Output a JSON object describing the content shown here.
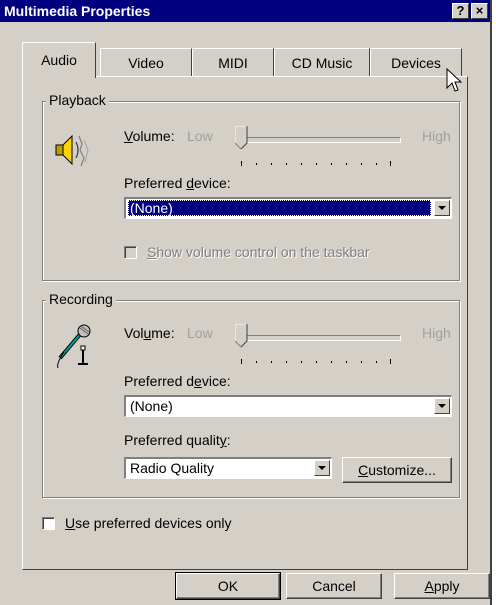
{
  "window": {
    "title": "Multimedia Properties",
    "help_glyph": "?",
    "close_glyph": "×"
  },
  "tabs": [
    {
      "label": "Audio",
      "active": true
    },
    {
      "label": "Video",
      "active": false
    },
    {
      "label": "MIDI",
      "active": false
    },
    {
      "label": "CD Music",
      "active": false
    },
    {
      "label": "Devices",
      "active": false
    }
  ],
  "playback": {
    "group_label": "Playback",
    "icon": "speaker-icon",
    "volume_label_pre": "",
    "volume_label_u": "V",
    "volume_label_post": "olume:",
    "low_label": "Low",
    "high_label": "High",
    "volume_level": 0,
    "preferred_device_label_pre": "Preferred ",
    "preferred_device_label_u": "d",
    "preferred_device_label_post": "evice:",
    "preferred_device_value": "(None)",
    "show_volume_u": "S",
    "show_volume_rest": "how volume control on the taskbar"
  },
  "recording": {
    "group_label": "Recording",
    "icon": "microphone-icon",
    "volume_label_pre": "Vol",
    "volume_label_u": "u",
    "volume_label_post": "me:",
    "low_label": "Low",
    "high_label": "High",
    "volume_level": 0,
    "preferred_device_label_pre": "Preferred d",
    "preferred_device_label_u": "e",
    "preferred_device_label_post": "vice:",
    "preferred_device_value": "(None)",
    "preferred_quality_label_pre": "Preferred qualit",
    "preferred_quality_label_u": "y",
    "preferred_quality_label_post": ":",
    "preferred_quality_value": "Radio Quality",
    "customize_u": "C",
    "customize_rest": "ustomize..."
  },
  "use_preferred": {
    "u": "U",
    "rest": "se preferred devices only",
    "checked": false
  },
  "buttons": {
    "ok": "OK",
    "cancel": "Cancel",
    "apply_u": "A",
    "apply_rest": "pply"
  }
}
